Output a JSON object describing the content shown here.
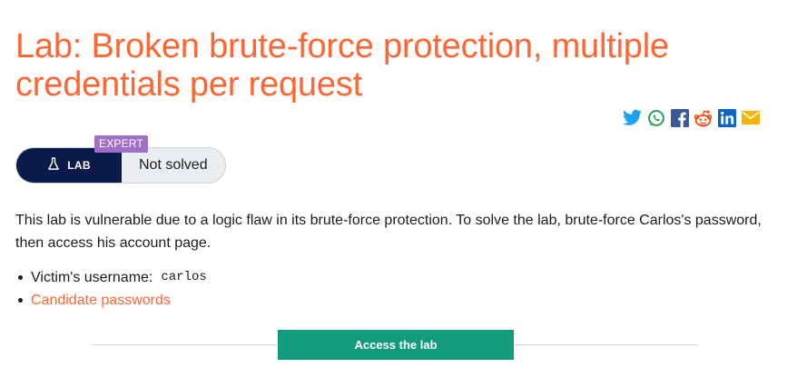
{
  "lab": {
    "title": "Lab: Broken brute-force protection, multiple credentials per request",
    "difficulty_badge": "EXPERT",
    "lab_label": "LAB",
    "status": "Not solved",
    "description": "This lab is vulnerable due to a logic flaw in its brute-force protection. To solve the lab, brute-force Carlos's password, then access his account page.",
    "facts": {
      "username_label": "Victim's username:",
      "username_value": "carlos",
      "passwords_link": "Candidate passwords"
    },
    "access_button": "Access the lab"
  },
  "share_icons": [
    "twitter-icon",
    "whatsapp-icon",
    "facebook-icon",
    "reddit-icon",
    "linkedin-icon",
    "email-icon"
  ],
  "colors": {
    "title": "#ff6633",
    "lab_pill": "#0a1a4a",
    "expert_badge": "#a070c8",
    "access_button": "#129b7d",
    "link": "#ff6633"
  }
}
